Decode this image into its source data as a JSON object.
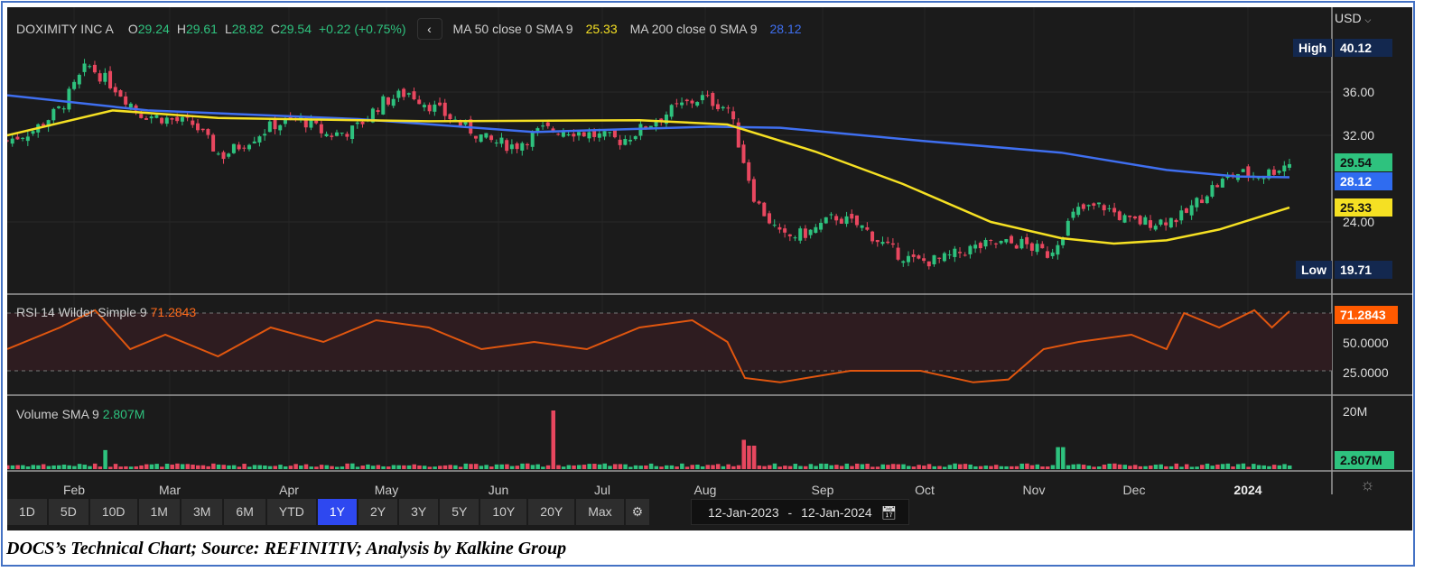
{
  "header": {
    "name": "DOXIMITY INC A",
    "o_label": "O",
    "o": "29.24",
    "h_label": "H",
    "h": "29.61",
    "l_label": "L",
    "l": "28.82",
    "c_label": "C",
    "c": "29.54",
    "change": "+0.22 (+0.75%)",
    "ma50_label": "MA 50 close 0 SMA 9",
    "ma50_value": "25.33",
    "ma200_label": "MA 200 close 0 SMA 9",
    "ma200_value": "28.12"
  },
  "currency": "USD",
  "price_axis": {
    "ticks": [
      "36.00",
      "32.00",
      "24.00"
    ],
    "high_label": "High",
    "high": "40.12",
    "low_label": "Low",
    "low": "19.71",
    "last": "29.54",
    "ma200_tag": "28.12",
    "ma50_tag": "25.33"
  },
  "rsi": {
    "label": "RSI 14 Wilder Simple 9",
    "value": "71.2843",
    "ticks": [
      "50.0000",
      "25.0000"
    ]
  },
  "volume": {
    "label": "Volume SMA 9",
    "value": "2.807M",
    "tick": "20M",
    "tag": "2.807M"
  },
  "months": [
    "Feb",
    "Mar",
    "Apr",
    "May",
    "Jun",
    "Jul",
    "Aug",
    "Sep",
    "Oct",
    "Nov",
    "Dec",
    "2024"
  ],
  "ranges": [
    "1D",
    "5D",
    "10D",
    "1M",
    "3M",
    "6M",
    "YTD",
    "1Y",
    "2Y",
    "3Y",
    "5Y",
    "10Y",
    "20Y",
    "Max"
  ],
  "active_range": "1Y",
  "date_range": {
    "from": "12-Jan-2023",
    "sep": "-",
    "to": "12-Jan-2024"
  },
  "caption": "DOCS’s Technical Chart; Source: REFINITIV; Analysis by Kalkine Group",
  "colors": {
    "up": "#2ec27e",
    "down": "#e8475f",
    "ma50": "#f5e023",
    "ma200": "#3f6ff0",
    "rsi": "#e0560f"
  },
  "chart_data": {
    "type": "candlestick",
    "x_range_days": [
      0,
      365
    ],
    "y_range": [
      19.71,
      40.12
    ],
    "weekly_close": [
      31.5,
      32.5,
      34.5,
      38.5,
      36.5,
      34.0,
      33.5,
      33.0,
      30.0,
      31.5,
      33.0,
      33.5,
      32.0,
      32.5,
      35.0,
      36.0,
      34.5,
      33.0,
      31.5,
      31.0,
      32.5,
      32.5,
      32.0,
      31.5,
      33.0,
      34.5,
      35.5,
      34.5,
      26.0,
      22.5,
      23.0,
      24.5,
      23.5,
      21.5,
      20.3,
      20.5,
      21.5,
      22.0,
      22.0,
      21.0,
      25.0,
      25.5,
      24.0,
      24.0,
      24.5,
      27.0,
      28.5,
      28.3,
      29.5
    ],
    "ma50": [
      [
        0,
        32
      ],
      [
        30,
        34.3
      ],
      [
        60,
        33.6
      ],
      [
        120,
        33.3
      ],
      [
        180,
        33.4
      ],
      [
        205,
        33
      ],
      [
        230,
        30.5
      ],
      [
        255,
        27.5
      ],
      [
        280,
        24
      ],
      [
        300,
        22.5
      ],
      [
        315,
        22
      ],
      [
        330,
        22.3
      ],
      [
        345,
        23.3
      ],
      [
        365,
        25.33
      ]
    ],
    "ma200": [
      [
        0,
        35.7
      ],
      [
        40,
        34.3
      ],
      [
        100,
        33.5
      ],
      [
        150,
        32.3
      ],
      [
        200,
        32.8
      ],
      [
        220,
        32.7
      ],
      [
        260,
        31.5
      ],
      [
        300,
        30.4
      ],
      [
        330,
        28.8
      ],
      [
        350,
        28.2
      ],
      [
        365,
        28.12
      ]
    ],
    "rsi_points": [
      [
        0,
        45
      ],
      [
        15,
        60
      ],
      [
        25,
        72
      ],
      [
        35,
        45
      ],
      [
        45,
        55
      ],
      [
        60,
        40
      ],
      [
        75,
        60
      ],
      [
        90,
        50
      ],
      [
        105,
        65
      ],
      [
        120,
        60
      ],
      [
        135,
        45
      ],
      [
        150,
        50
      ],
      [
        165,
        45
      ],
      [
        180,
        60
      ],
      [
        195,
        65
      ],
      [
        205,
        50
      ],
      [
        210,
        25
      ],
      [
        220,
        22
      ],
      [
        240,
        30
      ],
      [
        260,
        30
      ],
      [
        275,
        22
      ],
      [
        285,
        24
      ],
      [
        295,
        45
      ],
      [
        305,
        50
      ],
      [
        320,
        55
      ],
      [
        330,
        45
      ],
      [
        335,
        70
      ],
      [
        345,
        60
      ],
      [
        355,
        72
      ],
      [
        360,
        60
      ],
      [
        365,
        71.28
      ]
    ],
    "rsi_bands": [
      30,
      70
    ],
    "volume_base_millions": 1.3,
    "volume_spikes_millions": [
      [
        28,
        6.5
      ],
      [
        155,
        20
      ],
      [
        210,
        10
      ],
      [
        212,
        8
      ],
      [
        300,
        7.5
      ]
    ]
  }
}
